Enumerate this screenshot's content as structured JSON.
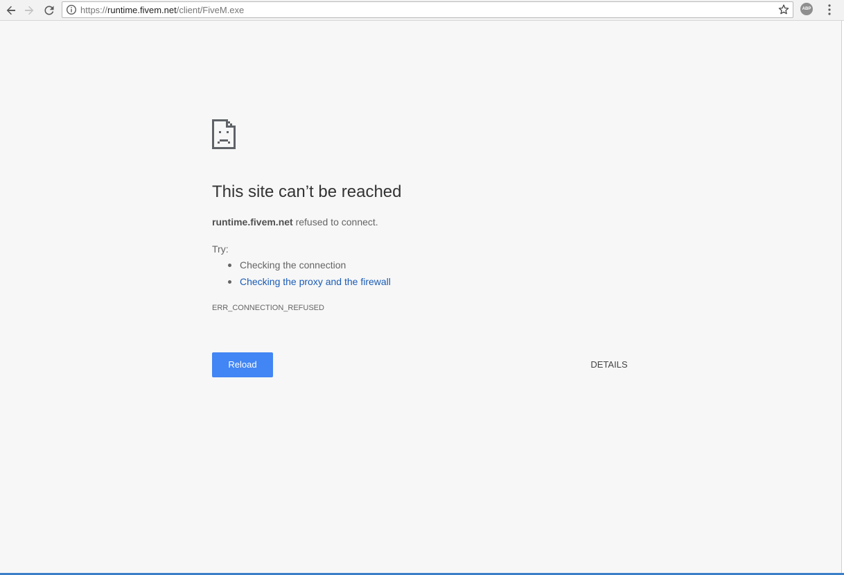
{
  "toolbar": {
    "back_icon": "arrow-left-icon",
    "forward_icon": "arrow-right-icon",
    "reload_icon": "reload-icon",
    "address": {
      "scheme": "https://",
      "host": "runtime.fivem.net",
      "path": "/client/FiveM.exe",
      "info_icon": "info-icon"
    },
    "bookmark_icon": "star-icon",
    "extension_label": "ABP",
    "menu_icon": "vertical-dots-icon"
  },
  "error_page": {
    "icon": "sad-document-icon",
    "heading": "This site can’t be reached",
    "summary_host": "runtime.fivem.net",
    "summary_text": " refused to connect.",
    "try_label": "Try:",
    "suggestions": [
      {
        "text": "Checking the connection",
        "is_link": false
      },
      {
        "text": "Checking the proxy and the firewall",
        "is_link": true
      }
    ],
    "error_code": "ERR_CONNECTION_REFUSED",
    "reload_label": "Reload",
    "details_label": "DETAILS"
  },
  "colors": {
    "page_background": "#f7f7f7",
    "primary_button": "#4285f4",
    "link": "#1a5bb5",
    "text": "#646464",
    "heading": "#333333"
  }
}
